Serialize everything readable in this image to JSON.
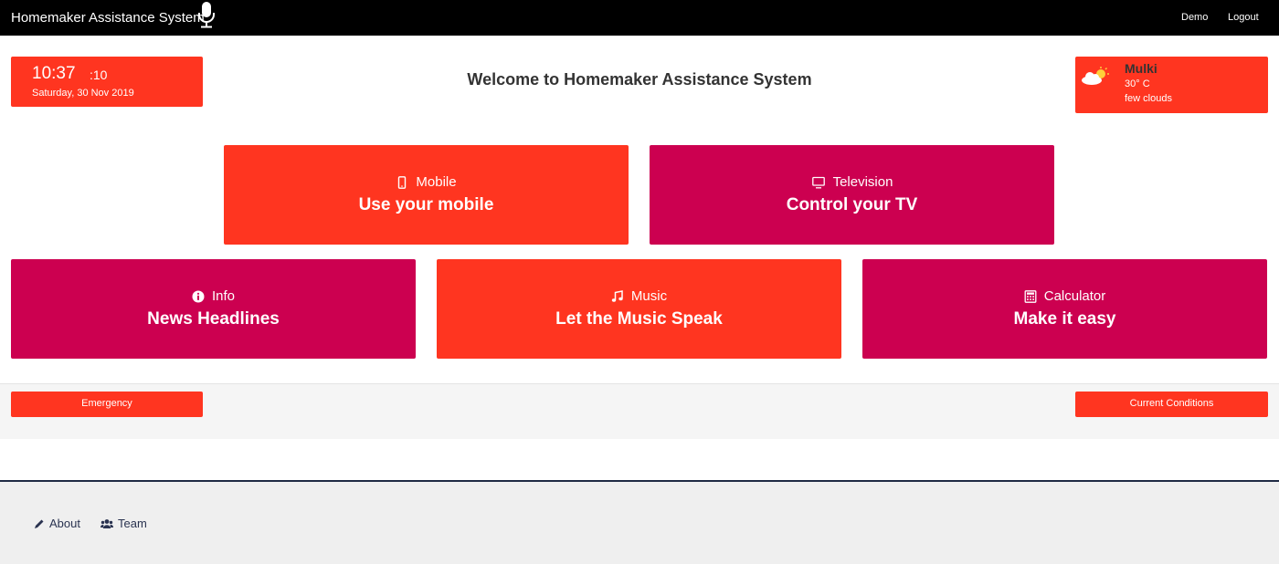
{
  "nav": {
    "brand": "Homemaker Assistance System",
    "links": [
      "Demo",
      "Logout"
    ]
  },
  "clock": {
    "time": "10:37",
    "seconds": ":10",
    "date": "Saturday, 30 Nov 2019"
  },
  "welcome": "Welcome to Homemaker Assistance System",
  "weather": {
    "city": "Mulki",
    "temp": "30° C",
    "desc": "few clouds",
    "icon": "partly-cloudy-icon"
  },
  "tiles": [
    {
      "label": "Mobile",
      "title": "Use your mobile",
      "icon": "mobile-icon",
      "color": "#ff3520"
    },
    {
      "label": "Television",
      "title": "Control your TV",
      "icon": "television-icon",
      "color": "#cc0050"
    },
    {
      "label": "Info",
      "title": "News Headlines",
      "icon": "info-icon",
      "color": "#cc0050"
    },
    {
      "label": "Music",
      "title": "Let the Music Speak",
      "icon": "music-icon",
      "color": "#ff3520"
    },
    {
      "label": "Calculator",
      "title": "Make it easy",
      "icon": "calculator-icon",
      "color": "#cc0050"
    }
  ],
  "actions": {
    "emergency": "Emergency",
    "conditions": "Current Conditions"
  },
  "footer": {
    "about": "About",
    "team": "Team"
  }
}
